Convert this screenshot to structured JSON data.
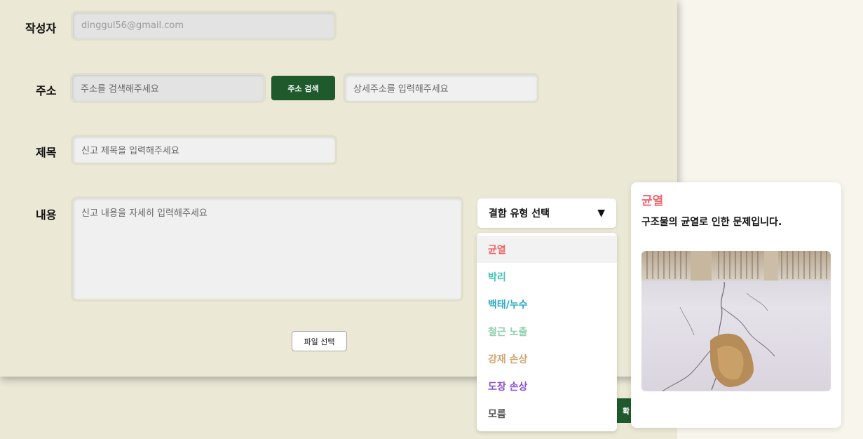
{
  "form": {
    "author": {
      "label": "작성자",
      "value": "dinggul56@gmail.com"
    },
    "address": {
      "label": "주소",
      "search_placeholder": "주소를 검색해주세요",
      "search_button": "주소 검색",
      "detail_placeholder": "상세주소를 입력해주세요"
    },
    "subject": {
      "label": "제목",
      "placeholder": "신고 제목을 입력해주세요"
    },
    "content": {
      "label": "내용",
      "placeholder": "신고 내용을 자세히 입력해주세요"
    },
    "file_button": "파일 선택",
    "confirm_button": "확"
  },
  "defect_select": {
    "placeholder": "결함 유형 선택",
    "arrow": "▼",
    "options": [
      {
        "label": "균열",
        "color": "#f0656a",
        "active": true
      },
      {
        "label": "박리",
        "color": "#3ec4b5"
      },
      {
        "label": "백태/누수",
        "color": "#29a9c8"
      },
      {
        "label": "철근 노출",
        "color": "#8fcfae"
      },
      {
        "label": "강재 손상",
        "color": "#d4a36c"
      },
      {
        "label": "도장 손상",
        "color": "#8a4fd6"
      },
      {
        "label": "모름",
        "color": "#555555"
      }
    ]
  },
  "info_card": {
    "title": "균열",
    "title_color": "#f0656a",
    "description": "구조물의 균열로 인한 문제입니다.",
    "image": "cracked-pavement-photo"
  }
}
